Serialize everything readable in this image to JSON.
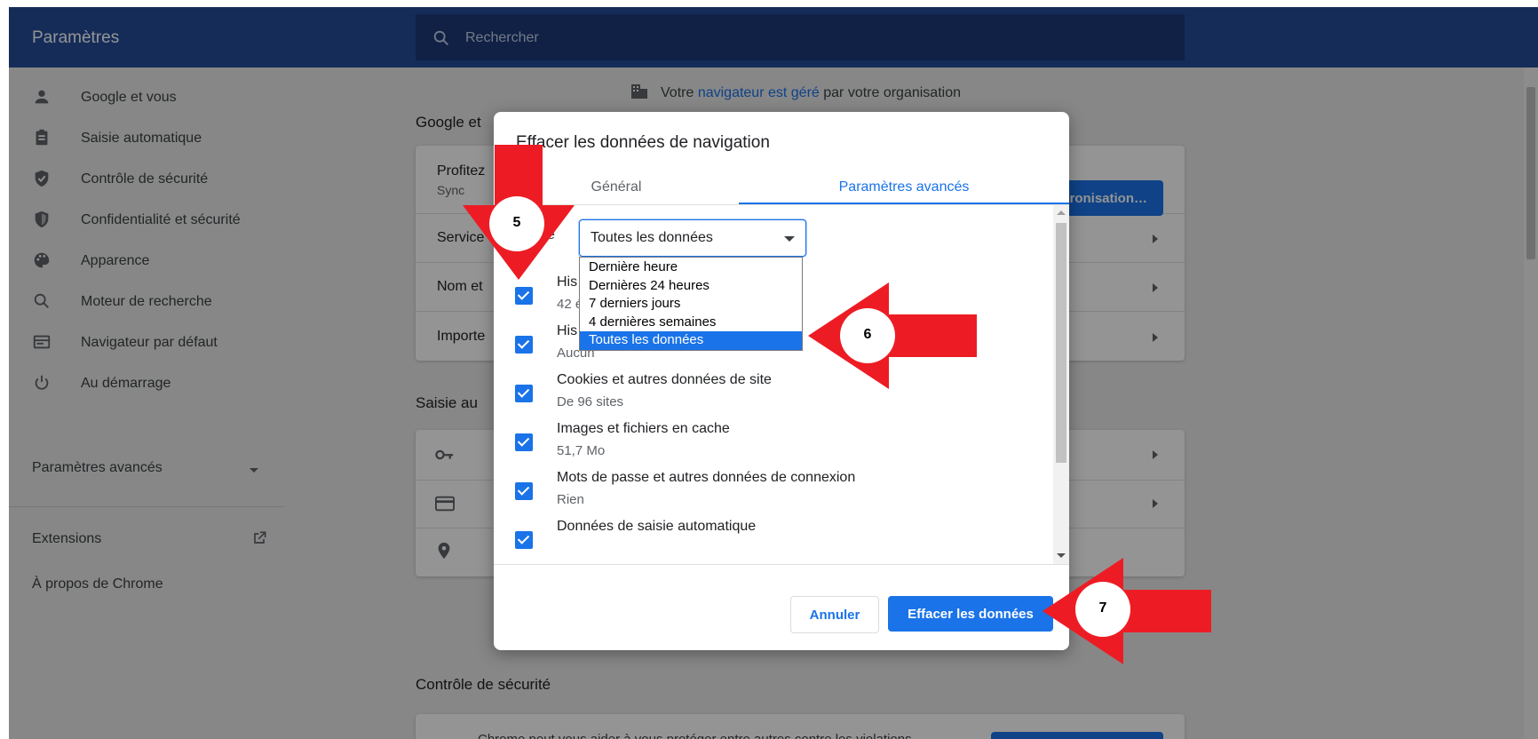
{
  "header": {
    "title": "Paramètres",
    "search_placeholder": "Rechercher"
  },
  "sidebar": {
    "items": [
      {
        "label": "Google et vous",
        "icon": "person-icon"
      },
      {
        "label": "Saisie automatique",
        "icon": "clipboard-icon"
      },
      {
        "label": "Contrôle de sécurité",
        "icon": "shield-check-icon"
      },
      {
        "label": "Confidentialité et sécurité",
        "icon": "shield-icon"
      },
      {
        "label": "Apparence",
        "icon": "palette-icon"
      },
      {
        "label": "Moteur de recherche",
        "icon": "search-icon"
      },
      {
        "label": "Navigateur par défaut",
        "icon": "browser-icon"
      },
      {
        "label": "Au démarrage",
        "icon": "power-icon"
      }
    ],
    "advanced_label": "Paramètres avancés",
    "extensions_label": "Extensions",
    "about_label": "À propos de Chrome"
  },
  "main": {
    "managed_prefix": "Votre ",
    "managed_link": "navigateur est géré",
    "managed_suffix": " par votre organisation",
    "section_google": "Google et",
    "google_card": {
      "profile_line": "Profitez",
      "sync_line": "Sync",
      "sync_button": "ronisation…",
      "row_services": "Service",
      "row_name": "Nom et",
      "row_import": "Importe"
    },
    "section_autofill": "Saisie au",
    "section_safety": "Contrôle de sécurité",
    "safety_text": "Chrome peut vous aider à vous protéger entre autres contre les violations"
  },
  "dialog": {
    "title": "Effacer les données de navigation",
    "tabs": [
      {
        "label": "Général"
      },
      {
        "label": "Paramètres avancés",
        "active": true
      }
    ],
    "range_label_fragment": "e",
    "range_selected": "Toutes les données",
    "options": [
      {
        "title": "His",
        "subtitle": "42 é",
        "checked": true
      },
      {
        "title": "His",
        "subtitle": "Aucun",
        "checked": true
      },
      {
        "title": "Cookies et autres données de site",
        "subtitle": "De 96 sites",
        "checked": true
      },
      {
        "title": "Images et fichiers en cache",
        "subtitle": "51,7 Mo",
        "checked": true
      },
      {
        "title": "Mots de passe et autres données de connexion",
        "subtitle": "Rien",
        "checked": true
      },
      {
        "title": "Données de saisie automatique",
        "subtitle": "",
        "checked": true
      }
    ],
    "dropdown_options": [
      "Dernière heure",
      "Dernières 24 heures",
      "7 derniers jours",
      "4 dernières semaines",
      "Toutes les données"
    ],
    "dropdown_selected_index": 4,
    "cancel_label": "Annuler",
    "clear_label": "Effacer les données"
  },
  "annotations": [
    {
      "label": "5"
    },
    {
      "label": "6"
    },
    {
      "label": "7"
    }
  ],
  "colors": {
    "header": "#254c9a",
    "accent": "#1a73e8",
    "annotation": "#ed1c24"
  }
}
